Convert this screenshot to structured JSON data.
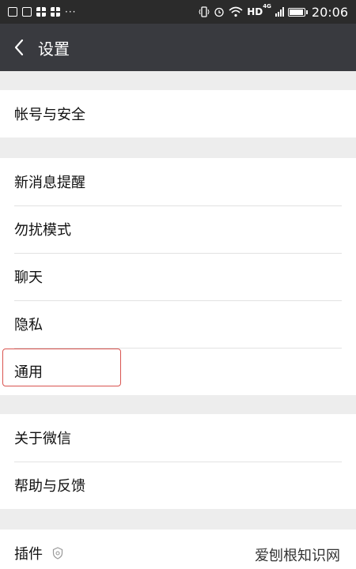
{
  "status_bar": {
    "more_dots": "···",
    "hd": "HD",
    "network": "4G",
    "time": "20:06",
    "battery_level": 0.95
  },
  "header": {
    "title": "设置",
    "back_icon": "chevron-left-icon"
  },
  "groups": [
    {
      "items": [
        {
          "label": "帐号与安全"
        }
      ]
    },
    {
      "items": [
        {
          "label": "新消息提醒"
        },
        {
          "label": "勿扰模式"
        },
        {
          "label": "聊天"
        },
        {
          "label": "隐私"
        },
        {
          "label": "通用"
        }
      ]
    },
    {
      "items": [
        {
          "label": "关于微信"
        },
        {
          "label": "帮助与反馈"
        }
      ]
    },
    {
      "items": [
        {
          "label": "插件",
          "icon": "plugin-icon"
        }
      ]
    }
  ],
  "watermark": "爱刨根知识网",
  "colors": {
    "header_bg": "#393a3f",
    "page_bg": "#ededed",
    "highlight": "#d9534f"
  }
}
